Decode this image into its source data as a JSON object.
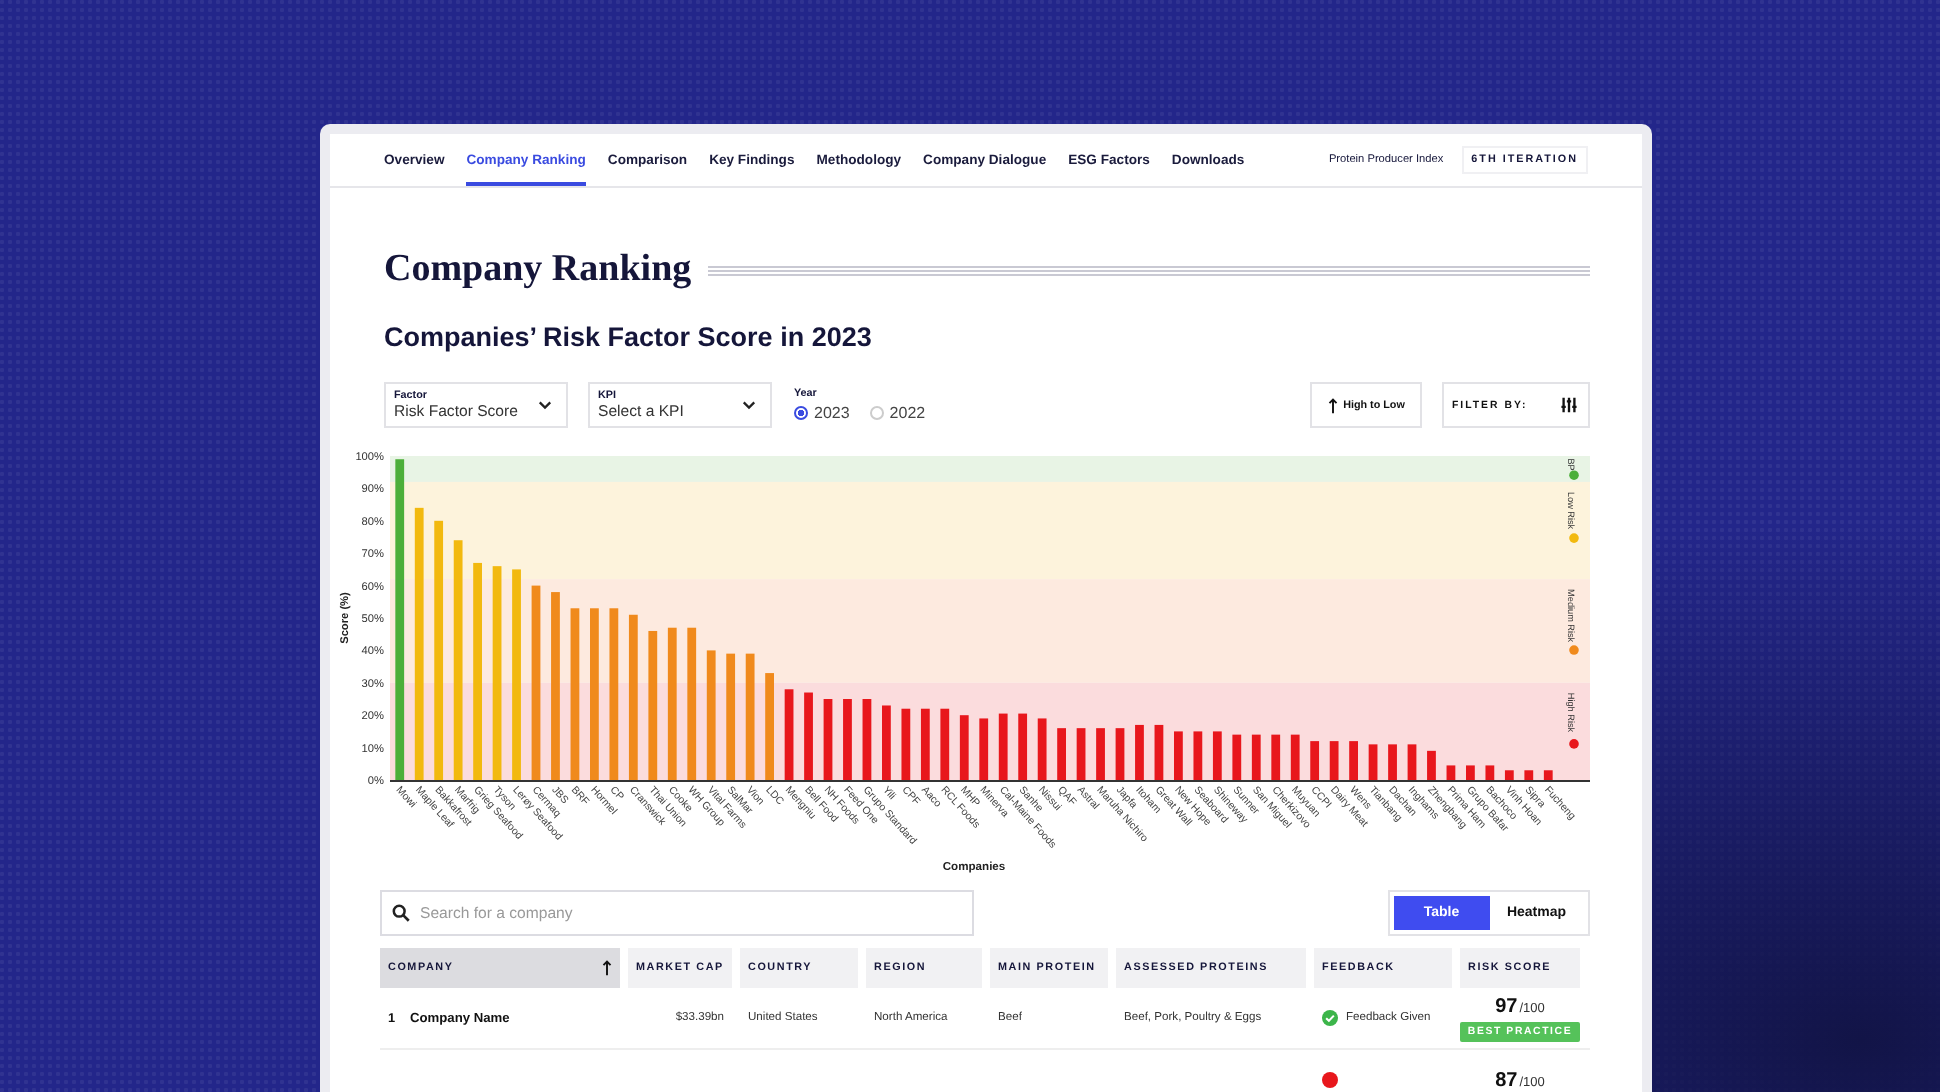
{
  "nav": {
    "items": [
      {
        "label": "Overview",
        "selected": false
      },
      {
        "label": "Company Ranking",
        "selected": true
      },
      {
        "label": "Comparison",
        "selected": false
      },
      {
        "label": "Key Findings",
        "selected": false
      },
      {
        "label": "Methodology",
        "selected": false
      },
      {
        "label": "Company Dialogue",
        "selected": false
      },
      {
        "label": "ESG Factors",
        "selected": false
      },
      {
        "label": "Downloads",
        "selected": false
      }
    ],
    "index_name": "Protein Producer Index",
    "iteration": "6TH ITERATION"
  },
  "page_title": "Company Ranking",
  "chart_title": "Companies’ Risk Factor Score in 2023",
  "controls": {
    "factor": {
      "label": "Factor",
      "value": "Risk Factor Score"
    },
    "kpi": {
      "label": "KPI",
      "placeholder": "Select a KPI"
    },
    "year": {
      "label": "Year",
      "options": [
        {
          "label": "2023",
          "selected": true
        },
        {
          "label": "2022",
          "selected": false
        }
      ]
    },
    "sort_button": "High to Low",
    "filter_label": "FILTER BY:"
  },
  "chart": {
    "chart_data": {
      "type": "bar",
      "xlabel": "Companies",
      "ylabel": "Score (%)",
      "categories": [
        "Mowi",
        "Maple Leaf",
        "Bakkafrost",
        "Marfrig",
        "Grieg Seafood",
        "Tyson",
        "Lerøy Seafood",
        "Cermaq",
        "JBS",
        "BRF",
        "Hormel",
        "CP",
        "Cranswick",
        "Thai Union",
        "Cooke",
        "WH Group",
        "Vital Farms",
        "SalMar",
        "Vion",
        "LDC",
        "Mengniu",
        "Bell Food",
        "NH Foods",
        "Feed One",
        "Grupo Standard",
        "Yili",
        "CPF",
        "Aaco",
        "RCL Foods",
        "MHP",
        "Minerva",
        "Cal-Maine Foods",
        "Sanhe",
        "Nissui",
        "QAF",
        "Astral",
        "Maruha Nichiro",
        "Japfa",
        "Itoham",
        "Great Wall",
        "New Hope",
        "Seaboard",
        "Shineway",
        "Sunner",
        "San Miguel",
        "Cherkizovo",
        "Muyuan",
        "CCPI",
        "Dairy Meat",
        "Wens",
        "Tianbang",
        "Dachan",
        "Inghams",
        "Zhengbang",
        "Prima Ham",
        "Grupo Bafar",
        "Bachoco",
        "Vinh Hoan",
        "Sipra",
        "Fucheng"
      ],
      "series": [
        {
          "name": "BP",
          "color": "#4caf3a",
          "values": [
            99,
            null,
            null,
            null,
            null,
            null,
            null,
            null,
            null,
            null,
            null,
            null,
            null,
            null,
            null,
            null,
            null,
            null,
            null,
            null,
            null,
            null,
            null,
            null,
            null,
            null,
            null,
            null,
            null,
            null,
            null,
            null,
            null,
            null,
            null,
            null,
            null,
            null,
            null,
            null,
            null,
            null,
            null,
            null,
            null,
            null,
            null,
            null,
            null,
            null,
            null,
            null,
            null,
            null,
            null,
            null,
            null,
            null,
            null,
            null
          ]
        },
        {
          "name": "Low Risk",
          "color": "#f2b90f",
          "values": [
            null,
            84,
            80,
            74,
            67,
            66,
            65,
            null,
            null,
            null,
            null,
            null,
            null,
            null,
            null,
            null,
            null,
            null,
            null,
            null,
            null,
            null,
            null,
            null,
            null,
            null,
            null,
            null,
            null,
            null,
            null,
            null,
            null,
            null,
            null,
            null,
            null,
            null,
            null,
            null,
            null,
            null,
            null,
            null,
            null,
            null,
            null,
            null,
            null,
            null,
            null,
            null,
            null,
            null,
            null,
            null,
            null,
            null,
            null,
            null
          ]
        },
        {
          "name": "Medium Risk",
          "color": "#f08a1c",
          "values": [
            null,
            null,
            null,
            null,
            null,
            null,
            null,
            60,
            58,
            53,
            53,
            53,
            51,
            46,
            47,
            47,
            40,
            39,
            39,
            33,
            null,
            null,
            null,
            null,
            null,
            null,
            null,
            null,
            null,
            null,
            null,
            null,
            null,
            null,
            null,
            null,
            null,
            null,
            null,
            null,
            null,
            null,
            null,
            null,
            null,
            null,
            null,
            null,
            null,
            null,
            null,
            null,
            null,
            null,
            null,
            null,
            null,
            null,
            null,
            null
          ]
        },
        {
          "name": "High Risk",
          "color": "#e8171c",
          "values": [
            null,
            null,
            null,
            null,
            null,
            null,
            null,
            null,
            null,
            null,
            null,
            null,
            null,
            null,
            null,
            null,
            null,
            null,
            null,
            null,
            28,
            27,
            25,
            25,
            25,
            23,
            22,
            22,
            22,
            20,
            19,
            20.5,
            20.5,
            19,
            16,
            16,
            16,
            16,
            17,
            17,
            15,
            15,
            15,
            14,
            14,
            14,
            14,
            12,
            12,
            12,
            11,
            11,
            11,
            9,
            4.5,
            4.5,
            4.5,
            3,
            3,
            3
          ]
        }
      ],
      "ylim": [
        0,
        100
      ],
      "yticks": [
        {
          "value": 0,
          "label": "0%"
        },
        {
          "value": 10,
          "label": "10%"
        },
        {
          "value": 20,
          "label": "20%"
        },
        {
          "value": 30,
          "label": "30%"
        },
        {
          "value": 40,
          "label": "40%"
        },
        {
          "value": 50,
          "label": "50%"
        },
        {
          "value": 60,
          "label": "60%"
        },
        {
          "value": 70,
          "label": "70%"
        },
        {
          "value": 80,
          "label": "80%"
        },
        {
          "value": 90,
          "label": "90%"
        },
        {
          "value": 100,
          "label": "100%"
        }
      ],
      "legend": "right",
      "bands": [
        {
          "axis": "y",
          "from": 92,
          "to": 100,
          "color": "#e8f4e5"
        },
        {
          "axis": "y",
          "from": 62,
          "to": 92,
          "color": "#fdf3dc"
        },
        {
          "axis": "y",
          "from": 30,
          "to": 62,
          "color": "#fdeadf"
        },
        {
          "axis": "y",
          "from": 0,
          "to": 30,
          "color": "#fbdcdd"
        }
      ]
    }
  },
  "search": {
    "placeholder": "Search for a company"
  },
  "view_toggle": [
    {
      "label": "Table",
      "selected": true
    },
    {
      "label": "Heatmap",
      "selected": false
    }
  ],
  "table": {
    "columns": [
      {
        "label": "COMPANY",
        "sorted": true
      },
      {
        "label": "MARKET CAP",
        "sorted": false
      },
      {
        "label": "COUNTRY",
        "sorted": false
      },
      {
        "label": "REGION",
        "sorted": false
      },
      {
        "label": "MAIN PROTEIN",
        "sorted": false
      },
      {
        "label": "ASSESSED PROTEINS",
        "sorted": false
      },
      {
        "label": "FEEDBACK",
        "sorted": false
      },
      {
        "label": "RISK SCORE",
        "sorted": false
      }
    ],
    "rows": [
      {
        "rank": "1",
        "company": "Company Name",
        "market_cap": "$33.39bn",
        "country": "United States",
        "region": "North America",
        "main_protein": "Beef",
        "assessed_proteins": "Beef, Pork, Poultry & Eggs",
        "feedback": {
          "given": true,
          "text": "Feedback Given"
        },
        "score": "97",
        "out_of": "/100",
        "badge": "BEST PRACTICE"
      },
      {
        "feedback": {
          "given": false
        },
        "score": "87",
        "out_of": "/100"
      }
    ]
  }
}
